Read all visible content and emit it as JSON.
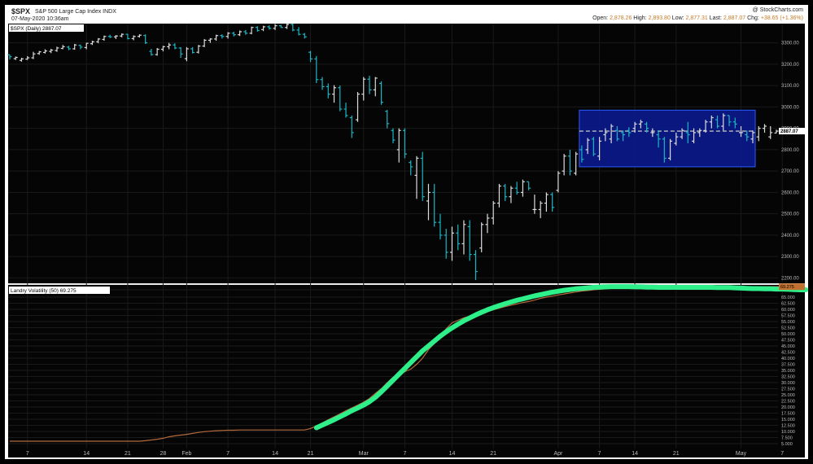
{
  "header": {
    "symbol": "$SPX",
    "name": "S&P 500 Large Cap Index  INDX",
    "date": "07-May-2020 10:36am",
    "brand": "@ StockCharts.com",
    "quote_open_label": "Open:",
    "quote_open": "2,878.26",
    "quote_high_label": "High:",
    "quote_high": "2,893.80",
    "quote_low_label": "Low:",
    "quote_low": "2,877.31",
    "quote_last_label": "Last:",
    "quote_last": "2,887.07",
    "quote_chg_label": "Chg:",
    "quote_chg": "+38.65 (+1.36%)"
  },
  "colors": {
    "panel_bg": "#050505",
    "grid": "#1a1a1a",
    "up_bar": "#dcdcdc",
    "down_bar": "#19b6c4",
    "box_fill": "#0b1a8c",
    "box_stroke": "#2a5cff",
    "volatility_line": "#b26a3c",
    "highlight_line": "#2ef08a",
    "axis_text": "#bbbbbb"
  },
  "chart_data": [
    {
      "type": "ohlc",
      "title": "$SPX (Daily) 2887.07",
      "y_ticks": [
        3300,
        3200,
        3100,
        3000,
        2900,
        2800,
        2700,
        2600,
        2500,
        2400,
        2300,
        2200
      ],
      "ylim": [
        2175,
        3390
      ],
      "last_value_label": "2887.07",
      "annotations": {
        "range_box": {
          "x_start": 97,
          "x_end": 126,
          "y_low": 2720,
          "y_high": 2985
        },
        "dashed_level": 2887
      },
      "x_axis_labels": [
        {
          "i": 3,
          "label": "7"
        },
        {
          "i": 13,
          "label": "14"
        },
        {
          "i": 20,
          "label": "21"
        },
        {
          "i": 26,
          "label": "28"
        },
        {
          "i": 30,
          "label": "Feb"
        },
        {
          "i": 37,
          "label": "7"
        },
        {
          "i": 45,
          "label": "14"
        },
        {
          "i": 51,
          "label": "21"
        },
        {
          "i": 60,
          "label": "Mar"
        },
        {
          "i": 67,
          "label": "7"
        },
        {
          "i": 75,
          "label": "14"
        },
        {
          "i": 82,
          "label": "21"
        },
        {
          "i": 93,
          "label": "Apr"
        },
        {
          "i": 100,
          "label": "7"
        },
        {
          "i": 106,
          "label": "14"
        },
        {
          "i": 113,
          "label": "21"
        },
        {
          "i": 124,
          "label": "May"
        },
        {
          "i": 131,
          "label": "7"
        }
      ],
      "bars": [
        [
          3244,
          3245,
          3222,
          3235
        ],
        [
          3226,
          3236,
          3220,
          3232
        ],
        [
          3218,
          3230,
          3212,
          3225
        ],
        [
          3224,
          3238,
          3220,
          3230
        ],
        [
          3230,
          3258,
          3224,
          3248
        ],
        [
          3250,
          3262,
          3244,
          3258
        ],
        [
          3255,
          3270,
          3250,
          3262
        ],
        [
          3260,
          3272,
          3252,
          3266
        ],
        [
          3264,
          3282,
          3258,
          3276
        ],
        [
          3274,
          3290,
          3270,
          3282
        ],
        [
          3280,
          3286,
          3266,
          3272
        ],
        [
          3272,
          3295,
          3268,
          3290
        ],
        [
          3288,
          3292,
          3270,
          3280
        ],
        [
          3278,
          3300,
          3270,
          3298
        ],
        [
          3296,
          3310,
          3290,
          3305
        ],
        [
          3305,
          3322,
          3298,
          3318
        ],
        [
          3316,
          3334,
          3310,
          3330
        ],
        [
          3330,
          3338,
          3322,
          3328
        ],
        [
          3328,
          3336,
          3318,
          3332
        ],
        [
          3332,
          3344,
          3326,
          3340
        ],
        [
          3340,
          3342,
          3316,
          3320
        ],
        [
          3320,
          3335,
          3312,
          3330
        ],
        [
          3330,
          3340,
          3325,
          3336
        ],
        [
          3334,
          3340,
          3295,
          3300
        ],
        [
          3260,
          3272,
          3240,
          3245
        ],
        [
          3245,
          3276,
          3240,
          3270
        ],
        [
          3270,
          3286,
          3260,
          3282
        ],
        [
          3282,
          3300,
          3270,
          3290
        ],
        [
          3290,
          3298,
          3270,
          3276
        ],
        [
          3276,
          3280,
          3230,
          3248
        ],
        [
          3226,
          3280,
          3214,
          3272
        ],
        [
          3272,
          3280,
          3250,
          3255
        ],
        [
          3256,
          3290,
          3250,
          3285
        ],
        [
          3285,
          3318,
          3280,
          3312
        ],
        [
          3312,
          3322,
          3300,
          3318
        ],
        [
          3318,
          3338,
          3310,
          3334
        ],
        [
          3334,
          3340,
          3320,
          3330
        ],
        [
          3330,
          3350,
          3320,
          3345
        ],
        [
          3345,
          3352,
          3330,
          3338
        ],
        [
          3338,
          3358,
          3332,
          3352
        ],
        [
          3352,
          3360,
          3338,
          3345
        ],
        [
          3345,
          3376,
          3340,
          3372
        ],
        [
          3372,
          3378,
          3352,
          3358
        ],
        [
          3362,
          3380,
          3355,
          3375
        ],
        [
          3375,
          3382,
          3362,
          3368
        ],
        [
          3368,
          3388,
          3360,
          3380
        ],
        [
          3380,
          3384,
          3370,
          3372
        ],
        [
          3372,
          3392,
          3365,
          3386
        ],
        [
          3386,
          3390,
          3354,
          3360
        ],
        [
          3360,
          3374,
          3335,
          3340
        ],
        [
          3340,
          3346,
          3320,
          3328
        ],
        [
          3256,
          3262,
          3210,
          3225
        ],
        [
          3225,
          3238,
          3112,
          3128
        ],
        [
          3128,
          3140,
          3080,
          3095
        ],
        [
          3095,
          3110,
          3040,
          3060
        ],
        [
          3060,
          3102,
          3020,
          3090
        ],
        [
          3090,
          3100,
          2980,
          2990
        ],
        [
          2990,
          3020,
          2950,
          2960
        ],
        [
          2950,
          2960,
          2855,
          2880
        ],
        [
          2940,
          3070,
          2930,
          3060
        ],
        [
          3060,
          3140,
          3030,
          3130
        ],
        [
          3130,
          3146,
          3060,
          3080
        ],
        [
          3080,
          3140,
          3050,
          3135
        ],
        [
          3110,
          3120,
          3010,
          3022
        ],
        [
          2980,
          2986,
          2900,
          2922
        ],
        [
          2890,
          2900,
          2830,
          2845
        ],
        [
          2800,
          2900,
          2740,
          2890
        ],
        [
          2890,
          2900,
          2760,
          2780
        ],
        [
          2740,
          2750,
          2680,
          2720
        ],
        [
          2680,
          2770,
          2570,
          2760
        ],
        [
          2760,
          2790,
          2560,
          2580
        ],
        [
          2560,
          2640,
          2470,
          2600
        ],
        [
          2600,
          2640,
          2440,
          2460
        ],
        [
          2460,
          2500,
          2380,
          2400
        ],
        [
          2400,
          2430,
          2290,
          2320
        ],
        [
          2320,
          2440,
          2280,
          2410
        ],
        [
          2410,
          2450,
          2330,
          2360
        ],
        [
          2360,
          2470,
          2310,
          2450
        ],
        [
          2440,
          2470,
          2280,
          2310
        ],
        [
          2310,
          2330,
          2190,
          2230
        ],
        [
          2340,
          2460,
          2320,
          2450
        ],
        [
          2450,
          2500,
          2410,
          2480
        ],
        [
          2480,
          2560,
          2450,
          2550
        ],
        [
          2550,
          2640,
          2530,
          2630
        ],
        [
          2630,
          2640,
          2560,
          2580
        ],
        [
          2580,
          2630,
          2550,
          2620
        ],
        [
          2620,
          2650,
          2590,
          2600
        ],
        [
          2600,
          2660,
          2580,
          2650
        ],
        [
          2650,
          2650,
          2610,
          2620
        ],
        [
          2520,
          2590,
          2500,
          2520
        ],
        [
          2520,
          2560,
          2480,
          2550
        ],
        [
          2550,
          2600,
          2510,
          2590
        ],
        [
          2590,
          2600,
          2510,
          2530
        ],
        [
          2610,
          2700,
          2600,
          2690
        ],
        [
          2700,
          2780,
          2680,
          2770
        ],
        [
          2770,
          2800,
          2680,
          2700
        ],
        [
          2690,
          2790,
          2680,
          2780
        ],
        [
          2800,
          2820,
          2740,
          2755
        ],
        [
          2800,
          2855,
          2780,
          2845
        ],
        [
          2850,
          2860,
          2770,
          2780
        ],
        [
          2770,
          2860,
          2750,
          2840
        ],
        [
          2870,
          2900,
          2840,
          2880
        ],
        [
          2850,
          2920,
          2830,
          2910
        ],
        [
          2890,
          2910,
          2840,
          2850
        ],
        [
          2880,
          2890,
          2840,
          2870
        ],
        [
          2890,
          2905,
          2860,
          2880
        ],
        [
          2900,
          2930,
          2880,
          2920
        ],
        [
          2920,
          2940,
          2900,
          2930
        ],
        [
          2920,
          2930,
          2880,
          2900
        ],
        [
          2880,
          2900,
          2860,
          2880
        ],
        [
          2870,
          2890,
          2810,
          2850
        ],
        [
          2850,
          2860,
          2740,
          2760
        ],
        [
          2760,
          2850,
          2750,
          2840
        ],
        [
          2830,
          2880,
          2820,
          2860
        ],
        [
          2860,
          2900,
          2850,
          2890
        ],
        [
          2880,
          2930,
          2830,
          2870
        ],
        [
          2840,
          2900,
          2830,
          2880
        ],
        [
          2880,
          2900,
          2860,
          2890
        ],
        [
          2890,
          2940,
          2880,
          2930
        ],
        [
          2930,
          2960,
          2900,
          2950
        ],
        [
          2940,
          2960,
          2900,
          2910
        ],
        [
          2910,
          2970,
          2890,
          2960
        ],
        [
          2960,
          2960,
          2910,
          2930
        ],
        [
          2930,
          2950,
          2900,
          2920
        ],
        [
          2880,
          2910,
          2860,
          2880
        ],
        [
          2870,
          2890,
          2840,
          2860
        ],
        [
          2850,
          2890,
          2830,
          2880
        ],
        [
          2860,
          2910,
          2840,
          2900
        ],
        [
          2900,
          2920,
          2880,
          2910
        ],
        [
          2860,
          2910,
          2850,
          2880
        ],
        [
          2878,
          2894,
          2877,
          2887
        ]
      ]
    },
    {
      "type": "line",
      "title": "Landry Volatility (50) 69.275",
      "y_ticks": [
        68,
        65,
        62.5,
        60,
        57.5,
        55,
        52.5,
        50,
        47.5,
        45,
        42.5,
        40,
        37.5,
        35,
        32.5,
        30,
        27.5,
        25,
        22.5,
        20,
        17.5,
        15,
        12.5,
        10,
        7.5,
        5
      ],
      "y_tick_labels": [
        "68.000",
        "65.000",
        "62.500",
        "60.000",
        "57.500",
        "55.000",
        "52.500",
        "50.000",
        "47.500",
        "45.000",
        "42.500",
        "40.000",
        "37.500",
        "35.000",
        "32.500",
        "30.000",
        "27.500",
        "25.000",
        "22.500",
        "20.000",
        "17.500",
        "15.000",
        "12.500",
        "10.000",
        "7.500",
        "5.000"
      ],
      "ylim": [
        3,
        70
      ],
      "last_value_label": "69.275",
      "series": [
        {
          "values": [
            6,
            6,
            6,
            6,
            6,
            6,
            6,
            6,
            6,
            6,
            6,
            6,
            6,
            6,
            6,
            6,
            6,
            6,
            6,
            6,
            6,
            6,
            6,
            6.2,
            6.5,
            6.8,
            7.2,
            7.8,
            8.2,
            8.5,
            8.8,
            9.2,
            9.6,
            9.9,
            10.1,
            10.3,
            10.4,
            10.5,
            10.5,
            10.6,
            10.6,
            10.6,
            10.6,
            10.6,
            10.6,
            10.6,
            10.6,
            10.6,
            10.6,
            10.6,
            10.6,
            11.2,
            12.3,
            13.5,
            14.8,
            16,
            17.2,
            18.5,
            19.6,
            20.8,
            22,
            23.5,
            25.6,
            27.5,
            30,
            32.2,
            33.5,
            34.5,
            35.5,
            37.5,
            40,
            43.5,
            46,
            48.5,
            52,
            54.5,
            55.5,
            56.5,
            57.2,
            57.8,
            58.5,
            59.1,
            59.8,
            60.5,
            61.1,
            61.7,
            62.2,
            62.8,
            63.2,
            63.8,
            64.5,
            65,
            65.4,
            65.9,
            66.3,
            66.7,
            67.1,
            67.5,
            67.7,
            68,
            68.2,
            68.4,
            68.6,
            68.7,
            68.8,
            68.9,
            69,
            69.1,
            69.2,
            69.2,
            69.3,
            69.3,
            69.3,
            69.3,
            69.3,
            69.3,
            69.3,
            69.3,
            69.3,
            69.3,
            69.3,
            69.3,
            69.3,
            69.3,
            69.3,
            69.3,
            69.3,
            69.3,
            69.3,
            69.3,
            69.3,
            69.3,
            69.3
          ]
        }
      ],
      "highlight": {
        "start_index": 52,
        "values": [
          11.5,
          12.6,
          13.7,
          14.8,
          16,
          17.2,
          18.5,
          19.6,
          20.8,
          22.2,
          24,
          26.2,
          28.6,
          31,
          33.4,
          35.8,
          38.2,
          40.6,
          43,
          45,
          47,
          49,
          50.8,
          52.4,
          53.9,
          55.3,
          56.5,
          57.7,
          58.8,
          59.8,
          60.7,
          61.5,
          62.3,
          63,
          63.7,
          64.3,
          64.9,
          65.5,
          66,
          66.5,
          67,
          67.4,
          67.8,
          68.1,
          68.4,
          68.6,
          68.8,
          69,
          69.1,
          69.2,
          69.3,
          69.3,
          69.3,
          69.3,
          69.2,
          69.2,
          69.1,
          69.1,
          69,
          69,
          69,
          69,
          69,
          69,
          69,
          69,
          69,
          69,
          68.9,
          68.9,
          68.9,
          68.8,
          68.7,
          68.6,
          68.5,
          68.5,
          68.4,
          68.4,
          68.3,
          68.3,
          68.2,
          68.1,
          68,
          68
        ]
      }
    }
  ]
}
